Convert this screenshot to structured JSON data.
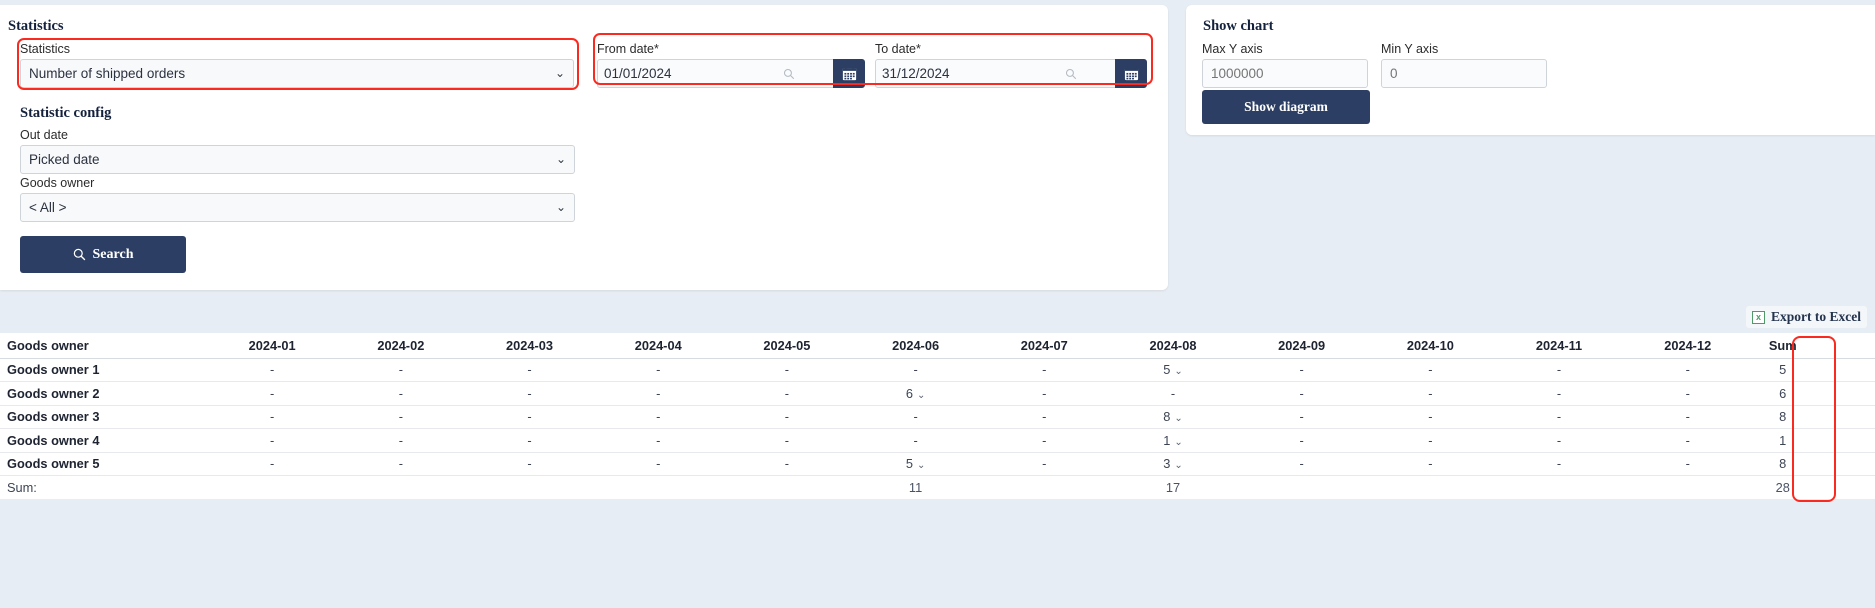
{
  "search_panel": {
    "title": "Statistics",
    "statistics_field": {
      "label": "Statistics",
      "value": "Number of shipped orders"
    },
    "from_date": {
      "label": "From date*",
      "value": "01/01/2024",
      "calendar_icon": "calendar-icon",
      "search_icon": "magnifier-icon"
    },
    "to_date": {
      "label": "To date*",
      "value": "31/12/2024",
      "calendar_icon": "calendar-icon",
      "search_icon": "magnifier-icon"
    },
    "config_title": "Statistic config",
    "out_date": {
      "label": "Out date",
      "value": "Picked date"
    },
    "goods_owner": {
      "label": "Goods owner",
      "value": "< All >"
    },
    "search_button": {
      "label": "Search",
      "icon": "search-icon"
    }
  },
  "chart_panel": {
    "title": "Show chart",
    "max_y": {
      "label": "Max Y axis",
      "value": "",
      "placeholder": "1000000"
    },
    "min_y": {
      "label": "Min Y axis",
      "value": "",
      "placeholder": "0"
    },
    "show_diagram_button": {
      "label": "Show diagram"
    }
  },
  "export": {
    "label": "Export to Excel",
    "icon": "excel-icon",
    "glyph": "x"
  },
  "colors": {
    "accent": "#2c3e63",
    "highlight": "#fb2a20",
    "page_bg": "#e7edf4",
    "excel_green": "#4f9a68"
  },
  "table": {
    "columns": [
      "Goods owner",
      "2024-01",
      "2024-02",
      "2024-03",
      "2024-04",
      "2024-05",
      "2024-06",
      "2024-07",
      "2024-08",
      "2024-09",
      "2024-10",
      "2024-11",
      "2024-12",
      "Sum"
    ],
    "rows": [
      {
        "owner": "Goods owner 1",
        "cells": [
          "-",
          "-",
          "-",
          "-",
          "-",
          "-",
          "-",
          "5",
          "-",
          "-",
          "-",
          "-"
        ],
        "expandable": [
          false,
          false,
          false,
          false,
          false,
          false,
          false,
          true,
          false,
          false,
          false,
          false
        ],
        "sum": "5"
      },
      {
        "owner": "Goods owner 2",
        "cells": [
          "-",
          "-",
          "-",
          "-",
          "-",
          "6",
          "-",
          "-",
          "-",
          "-",
          "-",
          "-"
        ],
        "expandable": [
          false,
          false,
          false,
          false,
          false,
          true,
          false,
          false,
          false,
          false,
          false,
          false
        ],
        "sum": "6"
      },
      {
        "owner": "Goods owner 3",
        "cells": [
          "-",
          "-",
          "-",
          "-",
          "-",
          "-",
          "-",
          "8",
          "-",
          "-",
          "-",
          "-"
        ],
        "expandable": [
          false,
          false,
          false,
          false,
          false,
          false,
          false,
          true,
          false,
          false,
          false,
          false
        ],
        "sum": "8"
      },
      {
        "owner": "Goods owner 4",
        "cells": [
          "-",
          "-",
          "-",
          "-",
          "-",
          "-",
          "-",
          "1",
          "-",
          "-",
          "-",
          "-"
        ],
        "expandable": [
          false,
          false,
          false,
          false,
          false,
          false,
          false,
          true,
          false,
          false,
          false,
          false
        ],
        "sum": "1"
      },
      {
        "owner": "Goods owner 5",
        "cells": [
          "-",
          "-",
          "-",
          "-",
          "-",
          "5",
          "-",
          "3",
          "-",
          "-",
          "-",
          "-"
        ],
        "expandable": [
          false,
          false,
          false,
          false,
          false,
          true,
          false,
          true,
          false,
          false,
          false,
          false
        ],
        "sum": "8"
      }
    ],
    "footer": {
      "label": "Sum:",
      "cells": [
        "",
        "",
        "",
        "",
        "",
        "11",
        "",
        "17",
        "",
        "",
        "",
        ""
      ],
      "sum": "28"
    },
    "caret_icon": "chevron-down-icon"
  }
}
